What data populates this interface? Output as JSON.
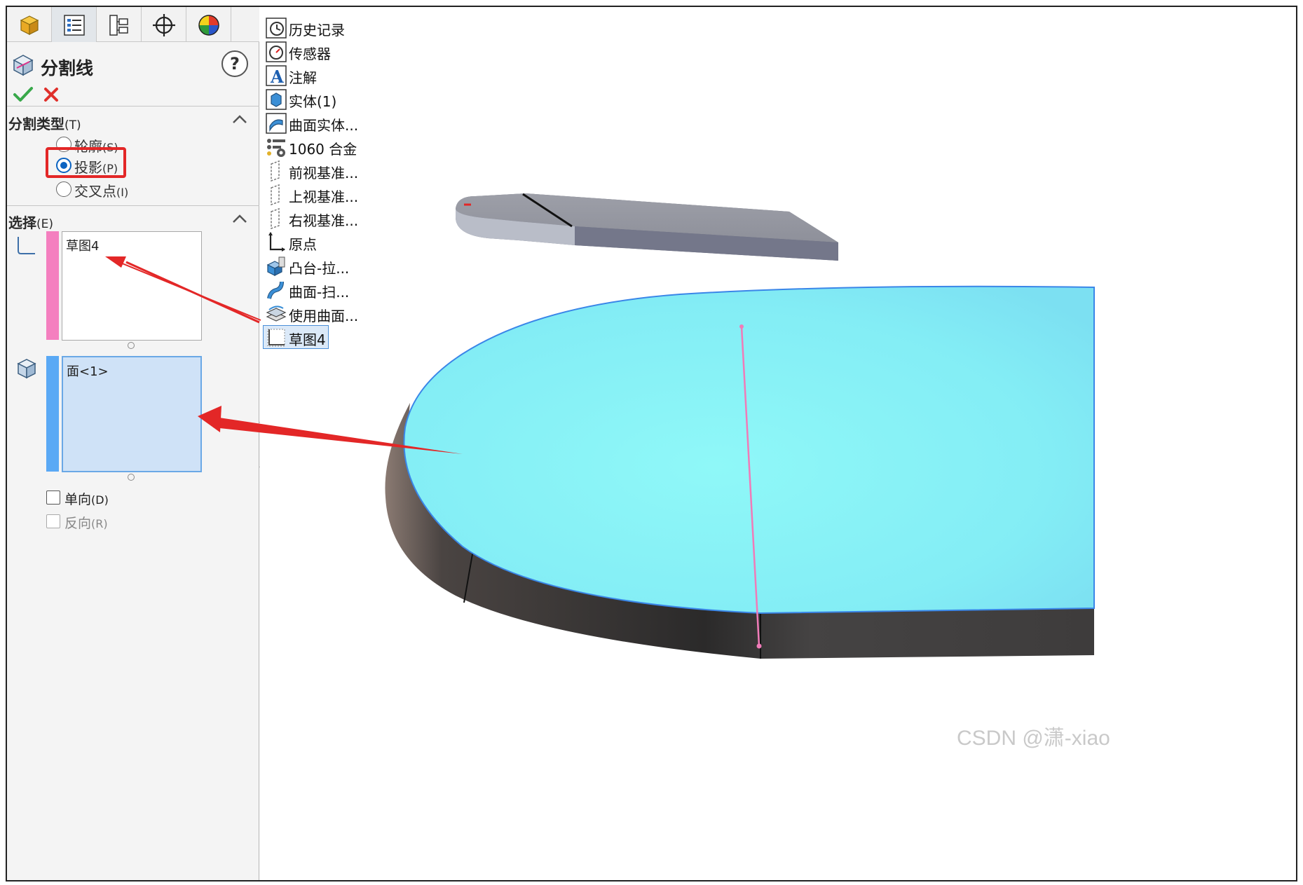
{
  "property_manager": {
    "tabs": [
      {
        "name": "feature-manager-tab"
      },
      {
        "name": "property-manager-tab"
      },
      {
        "name": "configuration-manager-tab"
      },
      {
        "name": "dimxpert-manager-tab"
      },
      {
        "name": "display-manager-tab"
      }
    ],
    "title": "分割线",
    "help": "?",
    "split_type": {
      "title": "分割类型",
      "title_accel": "(T)",
      "options": [
        {
          "label": "轮廓",
          "accel": "(S)",
          "checked": false
        },
        {
          "label": "投影",
          "accel": "(P)",
          "checked": true
        },
        {
          "label": "交叉点",
          "accel": "(I)",
          "checked": false
        }
      ]
    },
    "selection": {
      "title": "选择",
      "title_accel": "(E)",
      "sketch_list": {
        "item": "草图4",
        "color": "#f47fbf"
      },
      "face_list": {
        "item": "面<1>",
        "color": "#5aa9f5"
      }
    },
    "single_direction": {
      "label": "单向",
      "accel": "(D)",
      "checked": false
    },
    "reverse_direction": {
      "label": "反向",
      "accel": "(R)",
      "checked": false,
      "disabled": true
    }
  },
  "tree": {
    "items": [
      {
        "label": "历史记录",
        "expandable": true,
        "icon": "history-icon"
      },
      {
        "label": "传感器",
        "expandable": false,
        "icon": "sensor-icon"
      },
      {
        "label": "注解",
        "expandable": true,
        "icon": "annotation-icon"
      },
      {
        "label": "实体(1)",
        "expandable": true,
        "icon": "solid-body-icon"
      },
      {
        "label": "曲面实体...",
        "expandable": true,
        "icon": "surface-body-icon"
      },
      {
        "label": "1060 合金",
        "expandable": false,
        "icon": "material-icon"
      },
      {
        "label": "前视基准...",
        "expandable": false,
        "icon": "plane-icon"
      },
      {
        "label": "上视基准...",
        "expandable": false,
        "icon": "plane-icon"
      },
      {
        "label": "右视基准...",
        "expandable": false,
        "icon": "plane-icon"
      },
      {
        "label": "原点",
        "expandable": false,
        "icon": "origin-icon"
      },
      {
        "label": "凸台-拉...",
        "expandable": true,
        "icon": "extrude-icon"
      },
      {
        "label": "曲面-扫...",
        "expandable": true,
        "icon": "sweep-icon"
      },
      {
        "label": "使用曲面...",
        "expandable": false,
        "icon": "use-surface-icon"
      },
      {
        "label": "草图4",
        "expandable": false,
        "icon": "sketch-icon",
        "selected": true
      }
    ]
  },
  "colors": {
    "highlight": "#e32727",
    "face_fill": "#8ff5fb",
    "sketch_line": "#f07bb8",
    "body_dark": "#3a3838",
    "accent": "#0b63c1"
  },
  "watermark": "CSDN @潇-xiao"
}
